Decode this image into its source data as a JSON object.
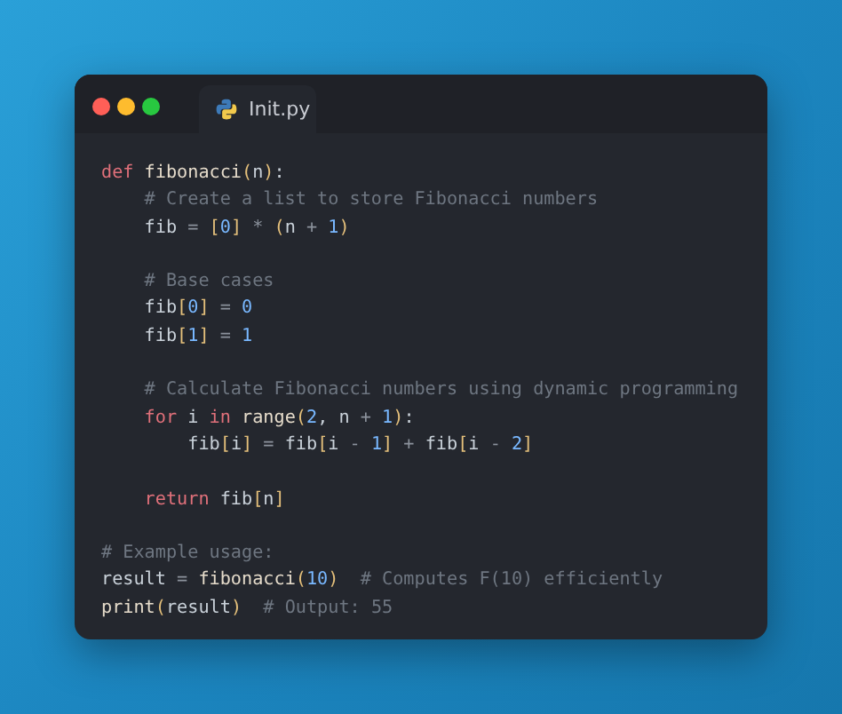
{
  "window": {
    "controls": [
      {
        "kind": "close"
      },
      {
        "kind": "minimize"
      },
      {
        "kind": "maximize"
      }
    ],
    "tab": {
      "label": "Init.py"
    }
  },
  "code": [
    {
      "tokens": [
        {
          "kind": "kw",
          "text": "def"
        },
        {
          "kind": "fn",
          "text": " fibonacci"
        },
        {
          "kind": "br",
          "text": "("
        },
        {
          "kind": "tx",
          "text": "n"
        },
        {
          "kind": "br",
          "text": ")"
        },
        {
          "kind": "tx",
          "text": ":"
        }
      ]
    },
    {
      "tokens": [
        {
          "kind": "cm",
          "text": "    # Create a list to store Fibonacci numbers"
        }
      ]
    },
    {
      "tokens": [
        {
          "kind": "tx",
          "text": "    fib "
        },
        {
          "kind": "op",
          "text": "= "
        },
        {
          "kind": "br",
          "text": "["
        },
        {
          "kind": "num",
          "text": "0"
        },
        {
          "kind": "br",
          "text": "]"
        },
        {
          "kind": "op",
          "text": " * "
        },
        {
          "kind": "br",
          "text": "("
        },
        {
          "kind": "tx",
          "text": "n "
        },
        {
          "kind": "op",
          "text": "+ "
        },
        {
          "kind": "num",
          "text": "1"
        },
        {
          "kind": "br",
          "text": ")"
        }
      ]
    },
    {
      "kind": "blank"
    },
    {
      "tokens": [
        {
          "kind": "cm",
          "text": "    # Base cases"
        }
      ]
    },
    {
      "tokens": [
        {
          "kind": "tx",
          "text": "    fib"
        },
        {
          "kind": "br",
          "text": "["
        },
        {
          "kind": "num",
          "text": "0"
        },
        {
          "kind": "br",
          "text": "]"
        },
        {
          "kind": "op",
          "text": " = "
        },
        {
          "kind": "num",
          "text": "0"
        }
      ]
    },
    {
      "tokens": [
        {
          "kind": "tx",
          "text": "    fib"
        },
        {
          "kind": "br",
          "text": "["
        },
        {
          "kind": "num",
          "text": "1"
        },
        {
          "kind": "br",
          "text": "]"
        },
        {
          "kind": "op",
          "text": " = "
        },
        {
          "kind": "num",
          "text": "1"
        }
      ]
    },
    {
      "kind": "blank"
    },
    {
      "tokens": [
        {
          "kind": "cm",
          "text": "    # Calculate Fibonacci numbers using dynamic programming"
        }
      ]
    },
    {
      "tokens": [
        {
          "kind": "kw",
          "text": "    for"
        },
        {
          "kind": "tx",
          "text": " i "
        },
        {
          "kind": "kw",
          "text": "in"
        },
        {
          "kind": "fn",
          "text": " range"
        },
        {
          "kind": "br",
          "text": "("
        },
        {
          "kind": "num",
          "text": "2"
        },
        {
          "kind": "tx",
          "text": ", n "
        },
        {
          "kind": "op",
          "text": "+ "
        },
        {
          "kind": "num",
          "text": "1"
        },
        {
          "kind": "br",
          "text": ")"
        },
        {
          "kind": "tx",
          "text": ":"
        }
      ]
    },
    {
      "tokens": [
        {
          "kind": "tx",
          "text": "        fib"
        },
        {
          "kind": "br",
          "text": "["
        },
        {
          "kind": "tx",
          "text": "i"
        },
        {
          "kind": "br",
          "text": "]"
        },
        {
          "kind": "op",
          "text": " = "
        },
        {
          "kind": "tx",
          "text": "fib"
        },
        {
          "kind": "br",
          "text": "["
        },
        {
          "kind": "tx",
          "text": "i "
        },
        {
          "kind": "op",
          "text": "- "
        },
        {
          "kind": "num",
          "text": "1"
        },
        {
          "kind": "br",
          "text": "]"
        },
        {
          "kind": "op",
          "text": " + "
        },
        {
          "kind": "tx",
          "text": "fib"
        },
        {
          "kind": "br",
          "text": "["
        },
        {
          "kind": "tx",
          "text": "i "
        },
        {
          "kind": "op",
          "text": "- "
        },
        {
          "kind": "num",
          "text": "2"
        },
        {
          "kind": "br",
          "text": "]"
        }
      ]
    },
    {
      "kind": "blank"
    },
    {
      "tokens": [
        {
          "kind": "kw",
          "text": "    return"
        },
        {
          "kind": "tx",
          "text": " fib"
        },
        {
          "kind": "br",
          "text": "["
        },
        {
          "kind": "tx",
          "text": "n"
        },
        {
          "kind": "br",
          "text": "]"
        }
      ]
    },
    {
      "kind": "blank"
    },
    {
      "tokens": [
        {
          "kind": "cm",
          "text": "# Example usage:"
        }
      ]
    },
    {
      "tokens": [
        {
          "kind": "tx",
          "text": "result "
        },
        {
          "kind": "op",
          "text": "= "
        },
        {
          "kind": "fn",
          "text": "fibonacci"
        },
        {
          "kind": "br",
          "text": "("
        },
        {
          "kind": "num",
          "text": "10"
        },
        {
          "kind": "br",
          "text": ")"
        },
        {
          "kind": "cm",
          "text": "  # Computes F(10) efficiently"
        }
      ]
    },
    {
      "tokens": [
        {
          "kind": "fn",
          "text": "print"
        },
        {
          "kind": "br",
          "text": "("
        },
        {
          "kind": "tx",
          "text": "result"
        },
        {
          "kind": "br",
          "text": ")"
        },
        {
          "kind": "cm",
          "text": "  # Output: 55"
        }
      ]
    }
  ]
}
